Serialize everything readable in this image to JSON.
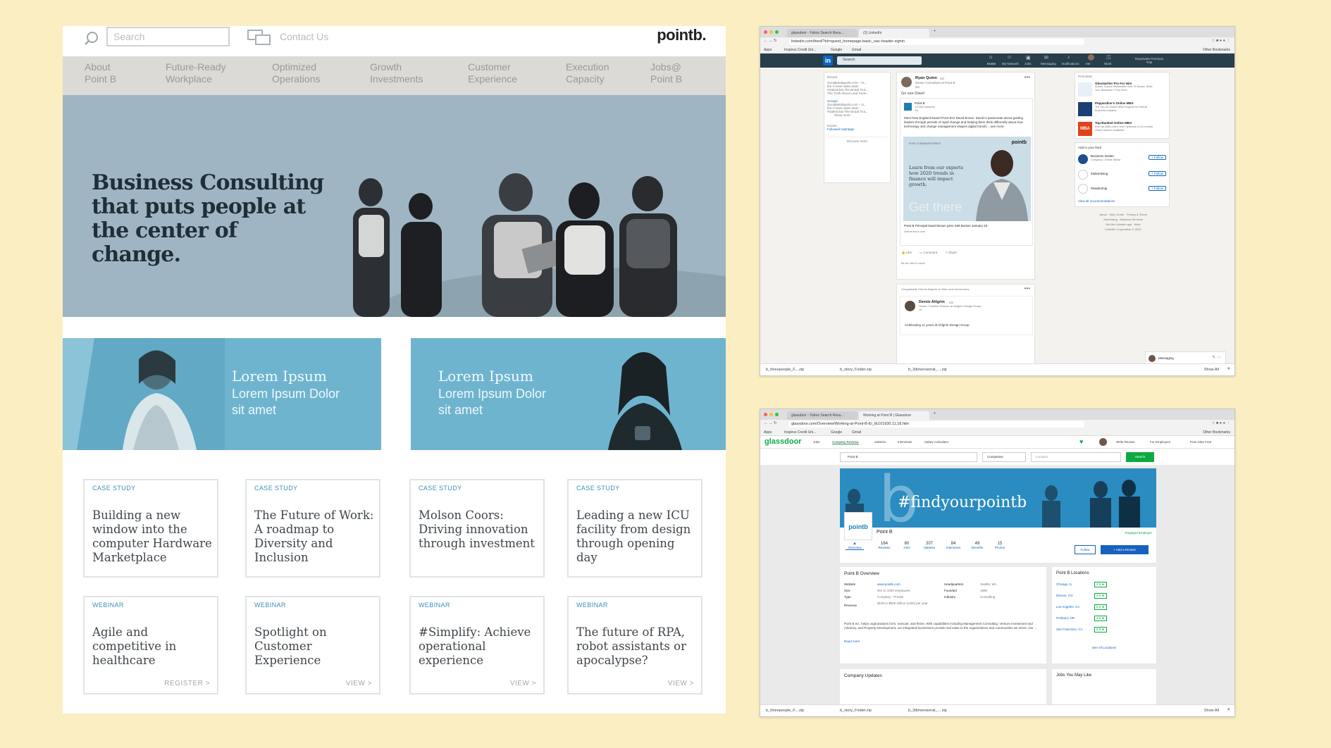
{
  "pointb_site": {
    "search_placeholder": "Search",
    "contact_label": "Contact Us",
    "logo": "pointb.",
    "nav": [
      {
        "line1": "About",
        "line2": "Point B"
      },
      {
        "line1": "Future-Ready",
        "line2": "Workplace"
      },
      {
        "line1": "Optimized",
        "line2": "Operations"
      },
      {
        "line1": "Growth",
        "line2": "Investments"
      },
      {
        "line1": "Customer",
        "line2": "Experience"
      },
      {
        "line1": "Execution",
        "line2": "Capacity"
      },
      {
        "line1": "Jobs@",
        "line2": "Point B"
      }
    ],
    "hero_title": "Business Consulting that puts people at the center of change.",
    "promos": [
      {
        "title": "Lorem Ipsum",
        "sub1": "Lorem Ipsum Dolor",
        "sub2": "sit amet"
      },
      {
        "title": "Lorem Ipsum",
        "sub1": "Lorem Ipsum Dolor",
        "sub2": "sit amet"
      }
    ],
    "cards": [
      {
        "tag": "CASE STUDY",
        "title": "Building a new window into the computer Hardware Marketplace",
        "action": ""
      },
      {
        "tag": "CASE STUDY",
        "title": "The Future of Work: A roadmap to Diversity and Inclusion",
        "action": ""
      },
      {
        "tag": "CASE STUDY",
        "title": "Molson Coors: Driving innovation through investment",
        "action": ""
      },
      {
        "tag": "CASE STUDY",
        "title": "Leading a new ICU facility from design through opening day",
        "action": ""
      },
      {
        "tag": "WEBINAR",
        "title": "Agile and competitive in healthcare",
        "action": "REGISTER >"
      },
      {
        "tag": "WEBINAR",
        "title": "Spotlight on Customer Experience",
        "action": "VIEW >"
      },
      {
        "tag": "WEBINAR",
        "title": "#Simplify: Achieve operational experience",
        "action": "VIEW >"
      },
      {
        "tag": "WEBINAR",
        "title": "The future of RPA, robot assistants or apocalypse?",
        "action": "VIEW >"
      }
    ]
  },
  "linkedin": {
    "tabs": [
      "glassdoor - Yahoo Search Resu...",
      "(3) LinkedIn"
    ],
    "url": "linkedin.com/feed/?trk=guest_homepage-basic_nav-header-signin",
    "bookmarks": [
      "Apps",
      "Inspirus Credit Uni...",
      "Google",
      "Gmail"
    ],
    "other_bookmarks": "Other Bookmarks",
    "search_placeholder": "Search",
    "nav": [
      "Home",
      "My Network",
      "Jobs",
      "Messaging",
      "Notifications",
      "Me",
      "Work",
      "Reactivate Premium Trial"
    ],
    "left": {
      "recent_label": "Recent",
      "recent": [
        "SocialMediapolis.com – N...",
        "the C-level sales team",
        "#SalesClub The Brutal Trut...",
        "The Truth About Lead Gene..."
      ],
      "groups_label": "Groups",
      "groups": [
        "SocialMediapolis.com – N...",
        "the C-level sales team",
        "#SalesClub The Brutal Trut..."
      ],
      "show_more": "Show more",
      "events": "Events",
      "followed": "Followed Hashtags",
      "discover": "Discover more"
    },
    "post": {
      "author": "Ryan Quinn",
      "degree": "· 1st",
      "headline": "Senior Consultant at Point B",
      "time": "2w",
      "text": "Go see Dave!",
      "share_company": "Point B",
      "share_followers": "13,054 followers",
      "share_time": "2w",
      "share_text": "Meet New England-based Point B'er David Brown. David is passionate about guiding leaders through periods of rapid change and helping them think differently about how technology and change management shapes digital transfo ...see more",
      "series": "POINT B WEBINAR SERIES",
      "image_text": "Learn from our experts how 2020 trends in finance will impact growth.",
      "image_logo": "pointb",
      "image_bg": "Get there",
      "link_title": "Point B Principal David Brown joins SIM Boston January 23",
      "link_source": "simnet.force.com",
      "actions": [
        "Like",
        "Comment",
        "Share"
      ],
      "first": "Be the first to react"
    },
    "post2": {
      "header": "Congratulate Dennis Ahlgrim on their work anniversary",
      "author": "Dennis Ahlgrim",
      "degree": "· 1st",
      "headline": "Owner, Creative Director at Ahlgrim Design Group",
      "time": "1d",
      "text": "Celebrating 11 years at Ahlgrim Design Group"
    },
    "promoted": {
      "label": "Promoted",
      "items": [
        {
          "title": "Ghostwriter Pro For Hire",
          "text": "Author, Expert Ghostwriter Over 70 Books. Write Your Bestseller. From $12k."
        },
        {
          "title": "Pepperdine's Online MBA",
          "text": "The Top-25 Online MBA Program for Ethical Business Leaders."
        },
        {
          "title": "Top-Ranked Online MBA",
          "text": "Earn an MBA online from Syracuse in 24 months. GMAT waivers available!"
        }
      ]
    },
    "feed_add": {
      "label": "Add to your feed",
      "items": [
        {
          "name": "Business Insider",
          "sub": "Company • Online Media",
          "btn": "+ Follow"
        },
        {
          "name": "#advertising",
          "sub": "",
          "btn": "+ Follow"
        },
        {
          "name": "#leadership",
          "sub": "",
          "btn": "+ Follow"
        }
      ],
      "view_all": "View all recommendations"
    },
    "footer": [
      "About",
      "Help Center",
      "Privacy & Terms",
      "Advertising",
      "Business Services",
      "Get the LinkedIn app",
      "More"
    ],
    "copyright": "LinkedIn Corporation © 2020",
    "messaging": "Messaging",
    "downloads": [
      "b_threepeople_F....zip",
      "b_story_Folder.zip",
      "b_3dimensional_....zip"
    ],
    "show_all": "Show All"
  },
  "glassdoor": {
    "tabs": [
      "glassdoor - Yahoo Search Resu...",
      "Working at Point B | Glassdoor"
    ],
    "url": "glassdoor.com/Overview/Working-at-Point-B-EI_IE101930.11,18.htm",
    "bookmarks": [
      "Apps",
      "Inspirus Credit Uni...",
      "Google",
      "Gmail"
    ],
    "other_bookmarks": "Other Bookmarks",
    "logo": "glassdoor",
    "nav": [
      "Jobs",
      "Company Reviews",
      "Salaries",
      "Interviews",
      "Salary Calculator"
    ],
    "right_nav": [
      "Write Review",
      "For Employers",
      "Post Jobs Free"
    ],
    "search_value": "Point B",
    "companies": "Companies",
    "location_placeholder": "Location",
    "search_btn": "Search",
    "banner_text": "#findyourpointb",
    "company_logo": "pointb",
    "company_name": "Point B",
    "engaged": "Engaged Employer",
    "stats": [
      {
        "num": "",
        "label": "Overview"
      },
      {
        "num": "164",
        "label": "Reviews"
      },
      {
        "num": "80",
        "label": "Jobs"
      },
      {
        "num": "207",
        "label": "Salaries"
      },
      {
        "num": "84",
        "label": "Interviews"
      },
      {
        "num": "49",
        "label": "Benefits"
      },
      {
        "num": "15",
        "label": "Photos"
      }
    ],
    "follow": "Follow",
    "add_review": "+ Add a Review",
    "overview_title": "Point B Overview",
    "overview_left": [
      {
        "k": "Website",
        "v": "www.pointb.com"
      },
      {
        "k": "Size",
        "v": "501 to 1000 employees"
      },
      {
        "k": "Type",
        "v": "Company - Private"
      },
      {
        "k": "Revenue",
        "v": "$100 to $500 million (USD) per year"
      }
    ],
    "overview_right": [
      {
        "k": "Headquarters",
        "v": "Seattle, WA"
      },
      {
        "k": "Founded",
        "v": "1995"
      },
      {
        "k": "Industry",
        "v": "Consulting"
      }
    ],
    "description": "Point B Inc. helps organizations form, execute, and thrive. With capabilities including Management Consulting, Venture Investment and Advisory, and Property Development, our integrated businesses provide real value to the organizations and communities we serve. Our ...",
    "read_more": "Read more",
    "company_updates": "Company Updates",
    "locations_title": "Point B Locations",
    "locations": [
      {
        "city": "Chicago, IL",
        "rating": "4.3 ★"
      },
      {
        "city": "Denver, CO",
        "rating": "4.6 ★"
      },
      {
        "city": "Los Angeles, CA",
        "rating": "5.0 ★"
      },
      {
        "city": "Portland, OR",
        "rating": "4.9 ★"
      },
      {
        "city": "San Francisco, CA",
        "rating": "5.0 ★"
      }
    ],
    "see_all": "See All Locations",
    "jobs_like": "Jobs You May Like",
    "downloads": [
      "b_threepeople_F....zip",
      "b_story_Folder.zip",
      "b_3dimensional_....zip"
    ],
    "show_all": "Show All"
  }
}
